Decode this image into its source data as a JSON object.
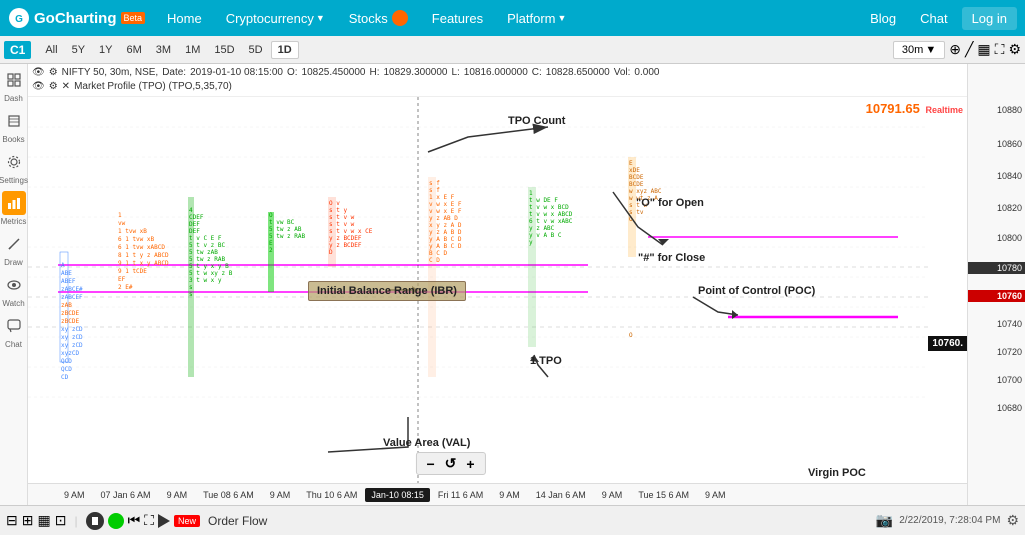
{
  "nav": {
    "logo": "GoCharting",
    "beta": "Beta",
    "items": [
      "Home",
      "Cryptocurrency",
      "Stocks",
      "Features",
      "Platform"
    ],
    "right_items": [
      "Blog",
      "Chat",
      "Log in"
    ],
    "crypto_label": "Cryptocurrency",
    "chat_label": "Chat"
  },
  "chart_controls": {
    "c1": "C1",
    "timeframes": [
      "All",
      "5Y",
      "1Y",
      "6M",
      "3M",
      "1M",
      "15D",
      "5D",
      "1D"
    ],
    "active_tf": "1D",
    "interval": "30m",
    "interval_dropdown": "▼"
  },
  "chart_info": {
    "symbol": "NIFTY 50, 30m, NSE,",
    "date_label": "Date:",
    "date_val": "2019-01-10 08:15:00",
    "o_label": "O:",
    "o_val": "10825.450000",
    "h_label": "H:",
    "h_val": "10829.300000",
    "l_label": "L:",
    "l_val": "10816.000000",
    "c_label": "C:",
    "c_val": "10828.650000",
    "vol_label": "Vol:",
    "vol_val": "0.000",
    "mp_label": "Market Profile (TPO) (TPO,5,35,70)"
  },
  "price_levels": [
    "10880",
    "10860",
    "10840",
    "10820",
    "10800",
    "10780",
    "10760",
    "10740",
    "10720",
    "10700",
    "10680"
  ],
  "current_price": "10791.65",
  "current_price_label": "10760.",
  "realtime": "Realtime",
  "annotations": {
    "tpo_count": "TPO Count",
    "open": "\"O\" for Open",
    "close": "\"#\" for Close",
    "poc": "Point of Control (POC)",
    "ibr": "Initial Balance Range (IBR)",
    "val": "Value Area (VAL)",
    "one_tpo": "1 TPO",
    "virgin_poc": "Virgin POC"
  },
  "time_labels": [
    "9 AM",
    "07 Jan  6 AM",
    "9 AM",
    "Tue 08  6 AM",
    "9 AM",
    "Thu 10  6 AM",
    "Fri 11  6 AM",
    "9 AM",
    "14 Jan  6 AM",
    "9 AM",
    "Tue 15  6 AM",
    "9 AM"
  ],
  "highlighted_time": "Jan-10 08:15",
  "bottom": {
    "order_flow": "Order Flow",
    "datetime": "2/22/2019, 7:28:04 PM"
  },
  "sidebar_items": [
    {
      "label": "Dash",
      "icon": "⊞"
    },
    {
      "label": "Books",
      "icon": "📖"
    },
    {
      "label": "Settings",
      "icon": "⚙"
    },
    {
      "label": "Metrics",
      "icon": "📊"
    },
    {
      "label": "Draw",
      "icon": "✏"
    },
    {
      "label": "Watch",
      "icon": "👁"
    },
    {
      "label": "Chat",
      "icon": "💬"
    }
  ],
  "zoom_controls": {
    "minus": "−",
    "reset": "↺",
    "plus": "+"
  }
}
